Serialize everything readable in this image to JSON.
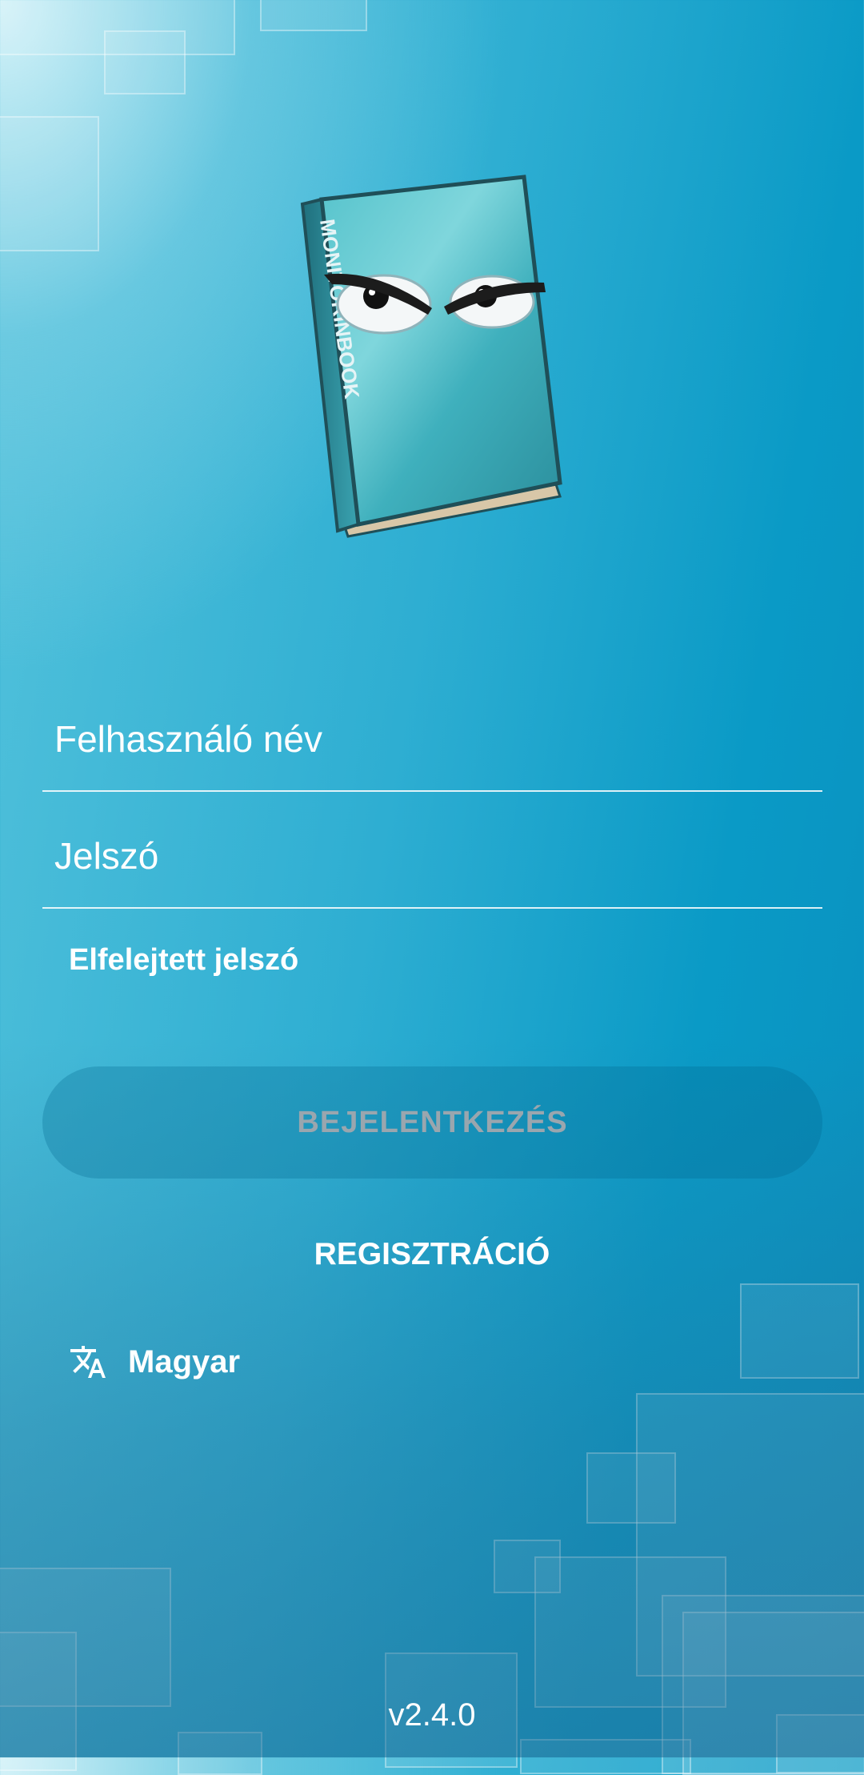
{
  "login_form": {
    "username_placeholder": "Felhasználó név",
    "password_placeholder": "Jelszó",
    "forgot_password": "Elfelejtett jelszó",
    "login_button": "BEJELENTKEZÉS",
    "register_button": "REGISZTRÁCIÓ"
  },
  "language": {
    "icon": "translate-icon",
    "label": "Magyar"
  },
  "logo": {
    "icon": "angry-book-logo",
    "spine_text": "MONITORINBOOK"
  },
  "version": "v2.4.0",
  "colors": {
    "background_top_left": "#dff5fa",
    "background_main": "#2eaed2",
    "background_right": "#0a8fbe",
    "login_button_bg": "#1a86ad",
    "login_button_text": "#9aa6ae",
    "text": "#ffffff"
  }
}
